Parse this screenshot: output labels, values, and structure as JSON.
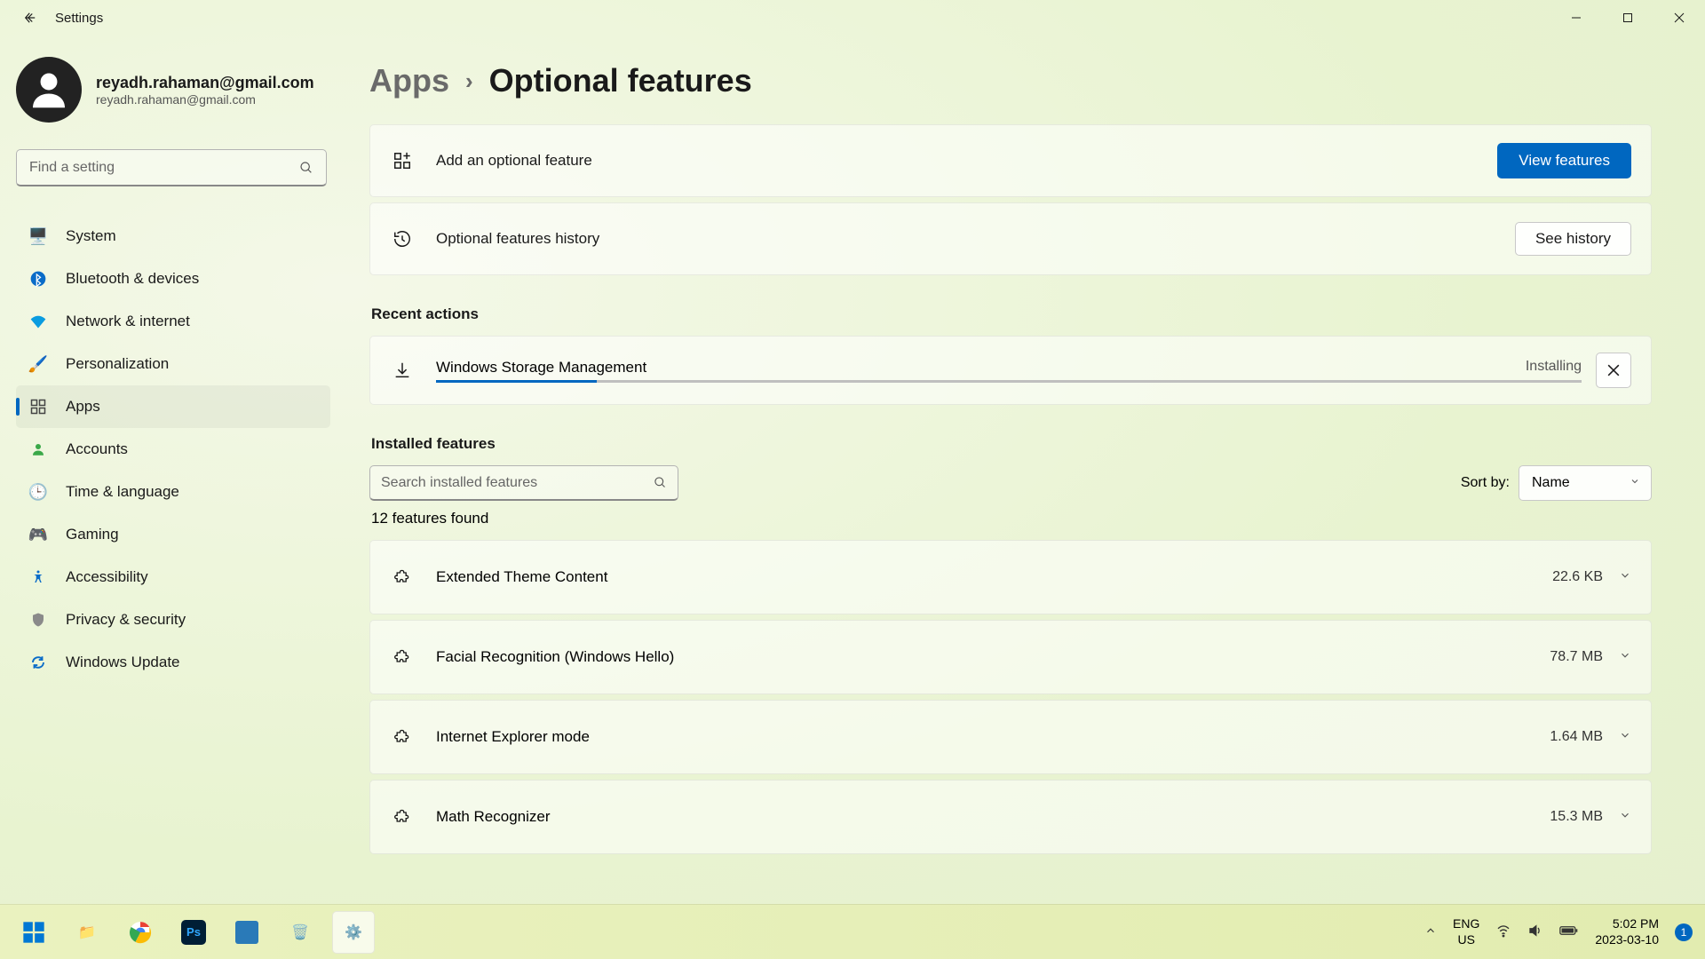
{
  "titlebar": {
    "label": "Settings"
  },
  "profile": {
    "email_main": "reyadh.rahaman@gmail.com",
    "email_sub": "reyadh.rahaman@gmail.com"
  },
  "search": {
    "placeholder": "Find a setting"
  },
  "nav": {
    "items": [
      {
        "label": "System"
      },
      {
        "label": "Bluetooth & devices"
      },
      {
        "label": "Network & internet"
      },
      {
        "label": "Personalization"
      },
      {
        "label": "Apps"
      },
      {
        "label": "Accounts"
      },
      {
        "label": "Time & language"
      },
      {
        "label": "Gaming"
      },
      {
        "label": "Accessibility"
      },
      {
        "label": "Privacy & security"
      },
      {
        "label": "Windows Update"
      }
    ]
  },
  "breadcrumb": {
    "parent": "Apps",
    "current": "Optional features"
  },
  "add_card": {
    "label": "Add an optional feature",
    "button": "View features"
  },
  "history_card": {
    "label": "Optional features history",
    "button": "See history"
  },
  "sections": {
    "recent": "Recent actions",
    "installed": "Installed features"
  },
  "recent": {
    "name": "Windows Storage Management",
    "status": "Installing"
  },
  "filter": {
    "search_placeholder": "Search installed features",
    "sort_label": "Sort by:",
    "sort_value": "Name"
  },
  "count": "12 features found",
  "features": [
    {
      "name": "Extended Theme Content",
      "size": "22.6 KB"
    },
    {
      "name": "Facial Recognition (Windows Hello)",
      "size": "78.7 MB"
    },
    {
      "name": "Internet Explorer mode",
      "size": "1.64 MB"
    },
    {
      "name": "Math Recognizer",
      "size": "15.3 MB"
    }
  ],
  "tray": {
    "lang1": "ENG",
    "lang2": "US",
    "time": "5:02 PM",
    "date": "2023-03-10",
    "badge": "1"
  }
}
